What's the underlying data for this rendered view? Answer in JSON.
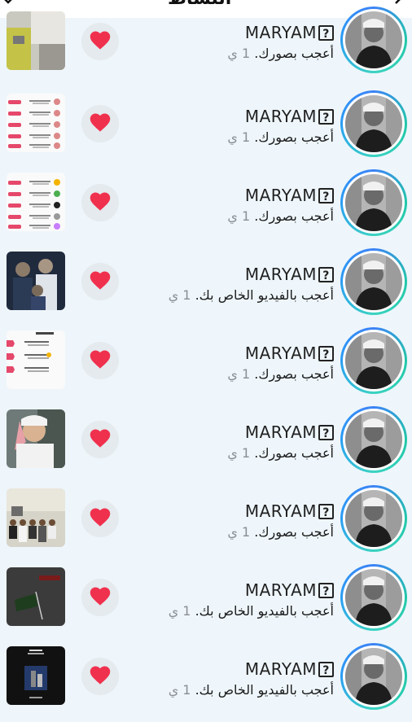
{
  "header": {
    "title": "النشاط",
    "chevron_icon": "chevron-down-icon",
    "back_icon": "back-arrow-icon"
  },
  "rows": [
    {
      "name": "MARYAM",
      "badge": "?",
      "action": "أعجب بصورك.",
      "time": "1 ي",
      "thumb": "photo-yellow"
    },
    {
      "name": "MARYAM",
      "badge": "?",
      "action": "أعجب بصورك.",
      "time": "1 ي",
      "thumb": "screenshot-list"
    },
    {
      "name": "MARYAM",
      "badge": "?",
      "action": "أعجب بصورك.",
      "time": "1 ي",
      "thumb": "screenshot-list-2"
    },
    {
      "name": "MARYAM",
      "badge": "?",
      "action": "أعجب بالفيديو الخاص بك.",
      "time": "1 ي",
      "thumb": "dark-people"
    },
    {
      "name": "MARYAM",
      "badge": "?",
      "action": "أعجب بصورك.",
      "time": "1 ي",
      "thumb": "screenshot-followers"
    },
    {
      "name": "MARYAM",
      "badge": "?",
      "action": "أعجب بصورك.",
      "time": "1 ي",
      "thumb": "smiling-boy"
    },
    {
      "name": "MARYAM",
      "badge": "?",
      "action": "أعجب بصورك.",
      "time": "1 ي",
      "thumb": "group-outdoor"
    },
    {
      "name": "MARYAM",
      "badge": "?",
      "action": "أعجب بالفيديو الخاص بك.",
      "time": "1 ي",
      "thumb": "flag-dark"
    },
    {
      "name": "MARYAM",
      "badge": "?",
      "action": "أعجب بالفيديو الخاص بك.",
      "time": "1 ي",
      "thumb": "dark-poster"
    }
  ],
  "colors": {
    "heart": "#f0314e",
    "ring_start": "#3b82f6",
    "ring_end": "#22c7a8",
    "background": "#eef6fb"
  }
}
